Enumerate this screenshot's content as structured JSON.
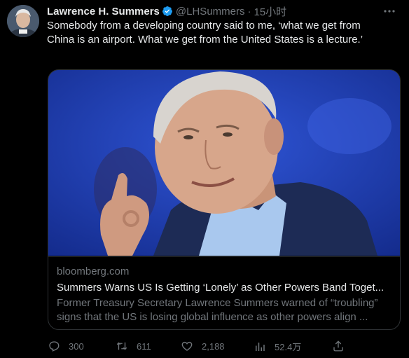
{
  "tweet": {
    "author_name": "Lawrence H. Summers",
    "handle": "@LHSummers",
    "separator": "·",
    "time": "15小时",
    "text": "Somebody from a developing country said to me, ‘what we get from China is an airport. What we get from the United States is a lecture.’"
  },
  "card": {
    "domain": "bloomberg.com",
    "title": "Summers Warns US Is Getting ‘Lonely’ as Other Powers Band Toget...",
    "description": "Former Treasury Secretary Lawrence Summers warned of “troubling” signs that the US is losing global influence as other powers align ..."
  },
  "actions": {
    "replies": "300",
    "retweets": "611",
    "likes": "2,188",
    "views": "52.4万"
  },
  "colors": {
    "background": "#000000",
    "text_primary": "#e7e9ea",
    "text_secondary": "#71767b",
    "verified_blue": "#1d9bf0",
    "border": "#2f3336"
  }
}
